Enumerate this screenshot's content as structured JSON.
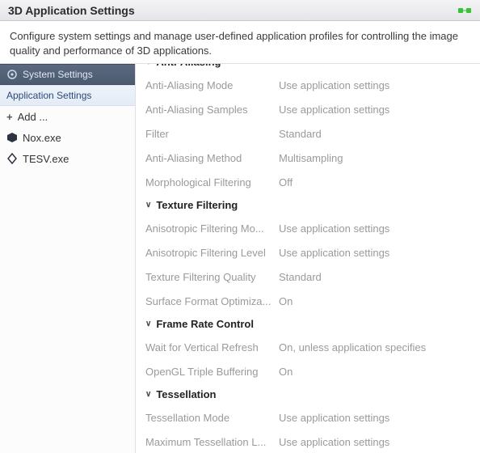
{
  "titlebar": {
    "title": "3D Application Settings"
  },
  "description": "Configure system settings and manage user-defined application profiles for controlling the image quality and performance of 3D applications.",
  "sidebar": {
    "section0": {
      "label": "System Settings"
    },
    "section1": {
      "label": "Application Settings"
    },
    "add_label": "Add ...",
    "apps": [
      {
        "label": "Nox.exe"
      },
      {
        "label": "TESV.exe"
      }
    ]
  },
  "groups": [
    {
      "name": "Anti-Aliasing",
      "rows": [
        {
          "label": "Anti-Aliasing Mode",
          "value": "Use application settings"
        },
        {
          "label": "Anti-Aliasing Samples",
          "value": "Use application settings"
        },
        {
          "label": "Filter",
          "value": "Standard"
        },
        {
          "label": "Anti-Aliasing Method",
          "value": "Multisampling"
        },
        {
          "label": "Morphological Filtering",
          "value": "Off"
        }
      ]
    },
    {
      "name": "Texture Filtering",
      "rows": [
        {
          "label": "Anisotropic Filtering Mo...",
          "value": "Use application settings"
        },
        {
          "label": "Anisotropic Filtering Level",
          "value": "Use application settings"
        },
        {
          "label": "Texture Filtering Quality",
          "value": "Standard"
        },
        {
          "label": "Surface Format Optimiza...",
          "value": "On"
        }
      ]
    },
    {
      "name": "Frame Rate Control",
      "rows": [
        {
          "label": "Wait for Vertical Refresh",
          "value": "On, unless application specifies"
        },
        {
          "label": "OpenGL Triple Buffering",
          "value": "On"
        }
      ]
    },
    {
      "name": "Tessellation",
      "rows": [
        {
          "label": "Tessellation Mode",
          "value": "Use application settings"
        },
        {
          "label": "Maximum Tessellation L...",
          "value": "Use application settings"
        }
      ]
    }
  ]
}
